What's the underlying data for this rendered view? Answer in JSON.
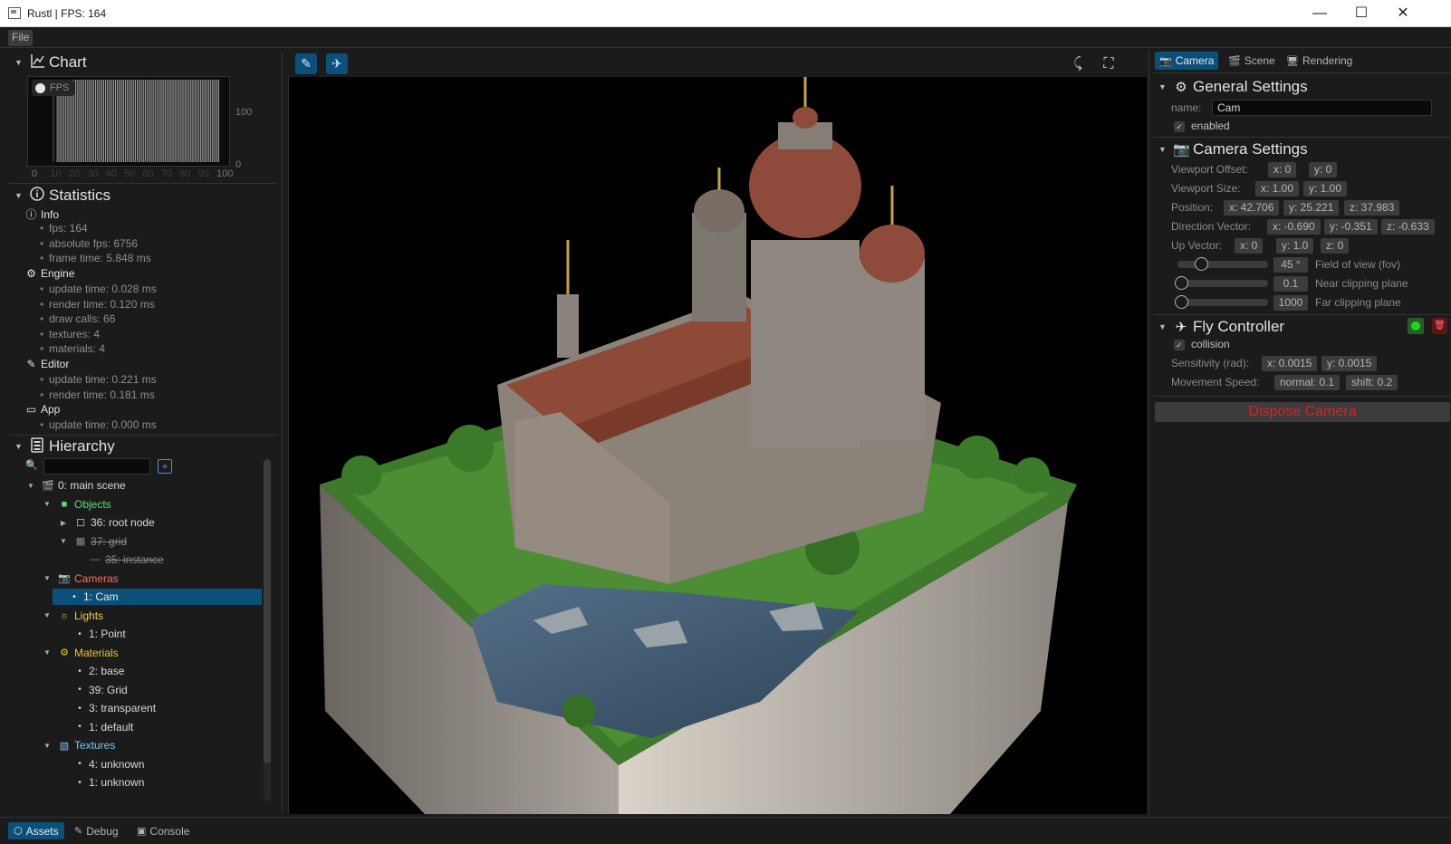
{
  "window": {
    "title": "Rustl | FPS: 164",
    "minimize": "—",
    "maximize": "☐",
    "close": "✕"
  },
  "menu": {
    "file": "File"
  },
  "chart": {
    "header": "Chart",
    "legend": "FPS",
    "y_max_label": "100",
    "y_min_label": "0",
    "x_tick_labels": [
      "0",
      "10",
      "20",
      "30",
      "40",
      "50",
      "60",
      "70",
      "80",
      "90",
      "100"
    ]
  },
  "chart_data": {
    "type": "bar",
    "series": [
      {
        "name": "FPS",
        "values": [
          0,
          0,
          100,
          100,
          100,
          100,
          100,
          100,
          100,
          100,
          100,
          100,
          100,
          100,
          100,
          100,
          100,
          100,
          100,
          100,
          100,
          100,
          100,
          100,
          100,
          100,
          100,
          100,
          100,
          100,
          100,
          100,
          100,
          100,
          100,
          100,
          100,
          100,
          100,
          100,
          100,
          100,
          100,
          100,
          100,
          100,
          100,
          100,
          100,
          100,
          100,
          100,
          100,
          100,
          100,
          100,
          100,
          100,
          100,
          100,
          100,
          100,
          100,
          100,
          100,
          100,
          100,
          100,
          100,
          100,
          100,
          100,
          100,
          100,
          100,
          100,
          100,
          100,
          100,
          100,
          100,
          100,
          100,
          100,
          100,
          100,
          100,
          100,
          100,
          100,
          100,
          100,
          100,
          100,
          100,
          100,
          100,
          100,
          100,
          100
        ]
      }
    ],
    "xlim": [
      0,
      100
    ],
    "ylim": [
      0,
      100
    ],
    "legend": "top-left"
  },
  "statistics": {
    "header": "Statistics",
    "groups": [
      {
        "title": "Info",
        "icon": "info-icon",
        "lines": [
          "fps: 164",
          "absolute fps: 6756",
          "frame time: 5.848 ms"
        ]
      },
      {
        "title": "Engine",
        "icon": "gear-icon",
        "lines": [
          "update time: 0.028 ms",
          "render time: 0.120 ms",
          "draw calls: 66",
          "textures: 4",
          "materials: 4"
        ]
      },
      {
        "title": "Editor",
        "icon": "pencil-icon",
        "lines": [
          "update time: 0.221 ms",
          "render time: 0.181 ms"
        ]
      },
      {
        "title": "App",
        "icon": "window-icon",
        "lines": [
          "update time: 0.000 ms"
        ]
      }
    ]
  },
  "hierarchy": {
    "header": "Hierarchy",
    "search_value": "",
    "add_label": "+",
    "rows": [
      {
        "label": "0: main scene",
        "arrow": "▼",
        "icon": "🎬",
        "color": "#d8d8d8"
      },
      {
        "label": "Objects",
        "arrow": "▼",
        "icon": "■",
        "color": "#4fe27a"
      },
      {
        "label": "36: root node",
        "arrow": "▶",
        "icon": "☐",
        "color": "#d8d8d8"
      },
      {
        "label": "37: grid",
        "arrow": "▼",
        "icon": "▦",
        "color": "#8a8a8a",
        "strike": true
      },
      {
        "label": "35: instance",
        "arrow": "",
        "icon": "—",
        "color": "#8a8a8a",
        "strike": true
      },
      {
        "label": "Cameras",
        "arrow": "▼",
        "icon": "📷",
        "color": "#ff6a6a"
      },
      {
        "label": "1: Cam",
        "arrow": "",
        "icon": "•",
        "color": "#e8e8e8",
        "selected": true
      },
      {
        "label": "Lights",
        "arrow": "▼",
        "icon": "☼",
        "color": "#e6d23c"
      },
      {
        "label": "1: Point",
        "arrow": "",
        "icon": "•",
        "color": "#d8d8d8"
      },
      {
        "label": "Materials",
        "arrow": "▼",
        "icon": "⚙",
        "color": "#f0c22a"
      },
      {
        "label": "2: base",
        "arrow": "",
        "icon": "•",
        "color": "#d8d8d8"
      },
      {
        "label": "39: Grid",
        "arrow": "",
        "icon": "•",
        "color": "#d8d8d8"
      },
      {
        "label": "3: transparent",
        "arrow": "",
        "icon": "•",
        "color": "#d8d8d8"
      },
      {
        "label": "1: default",
        "arrow": "",
        "icon": "•",
        "color": "#d8d8d8"
      },
      {
        "label": "Textures",
        "arrow": "▼",
        "icon": "▧",
        "color": "#7ec5f0"
      },
      {
        "label": "4: unknown",
        "arrow": "",
        "icon": "•",
        "color": "#d8d8d8"
      },
      {
        "label": "1: unknown",
        "arrow": "",
        "icon": "•",
        "color": "#d8d8d8"
      }
    ]
  },
  "bottom_tabs": [
    {
      "label": "Assets",
      "icon": "assets-icon",
      "active": true
    },
    {
      "label": "Debug",
      "icon": "pencil-icon",
      "active": false
    },
    {
      "label": "Console",
      "icon": "console-icon",
      "active": false
    }
  ],
  "viewport": {
    "select_tool": "✎",
    "fly_tool": "✈",
    "pick_icon": "⤹",
    "fullscreen_icon": "⛶"
  },
  "inspector": {
    "tabs": [
      {
        "label": "Camera",
        "active": true
      },
      {
        "label": "Scene",
        "active": false
      },
      {
        "label": "Rendering",
        "active": false
      }
    ],
    "general": {
      "header": "General Settings",
      "name_label": "name:",
      "name_value": "Cam",
      "enabled_label": "enabled",
      "enabled": true
    },
    "camera": {
      "header": "Camera Settings",
      "viewport_offset_label": "Viewport Offset:",
      "viewport_offset": [
        "x: 0",
        "y: 0"
      ],
      "viewport_size_label": "Viewport Size:",
      "viewport_size": [
        "x: 1.00",
        "y: 1.00"
      ],
      "position_label": "Position:",
      "position": [
        "x: 42.706",
        "y: 25.221",
        "z: 37.983"
      ],
      "direction_label": "Direction Vector:",
      "direction": [
        "x: -0.690",
        "y: -0.351",
        "z: -0.633"
      ],
      "up_label": "Up Vector:",
      "up": [
        "x: 0",
        "y: 1.0",
        "z: 0"
      ],
      "fov_value": "45 °",
      "fov_label": "Field of view (fov)",
      "fov_fraction": 0.25,
      "near_value": "0.1",
      "near_label": "Near clipping plane",
      "near_fraction": 0.0,
      "far_value": "1000",
      "far_label": "Far clipping plane",
      "far_fraction": 0.0
    },
    "fly": {
      "header": "Fly Controller",
      "collision_label": "collision",
      "collision": true,
      "sensitivity_label": "Sensitivity (rad):",
      "sensitivity": [
        "x: 0.0015",
        "y: 0.0015"
      ],
      "speed_label": "Movement Speed:",
      "speed": [
        "normal: 0.1",
        "shift: 0.2"
      ],
      "status_color": "#1bd81b"
    },
    "dispose_label": "Dispose Camera",
    "dispose_color": "#e12020"
  },
  "colors": {
    "accent": "#0b5079",
    "background": "#1b1b1b",
    "panel_border": "#333333"
  }
}
